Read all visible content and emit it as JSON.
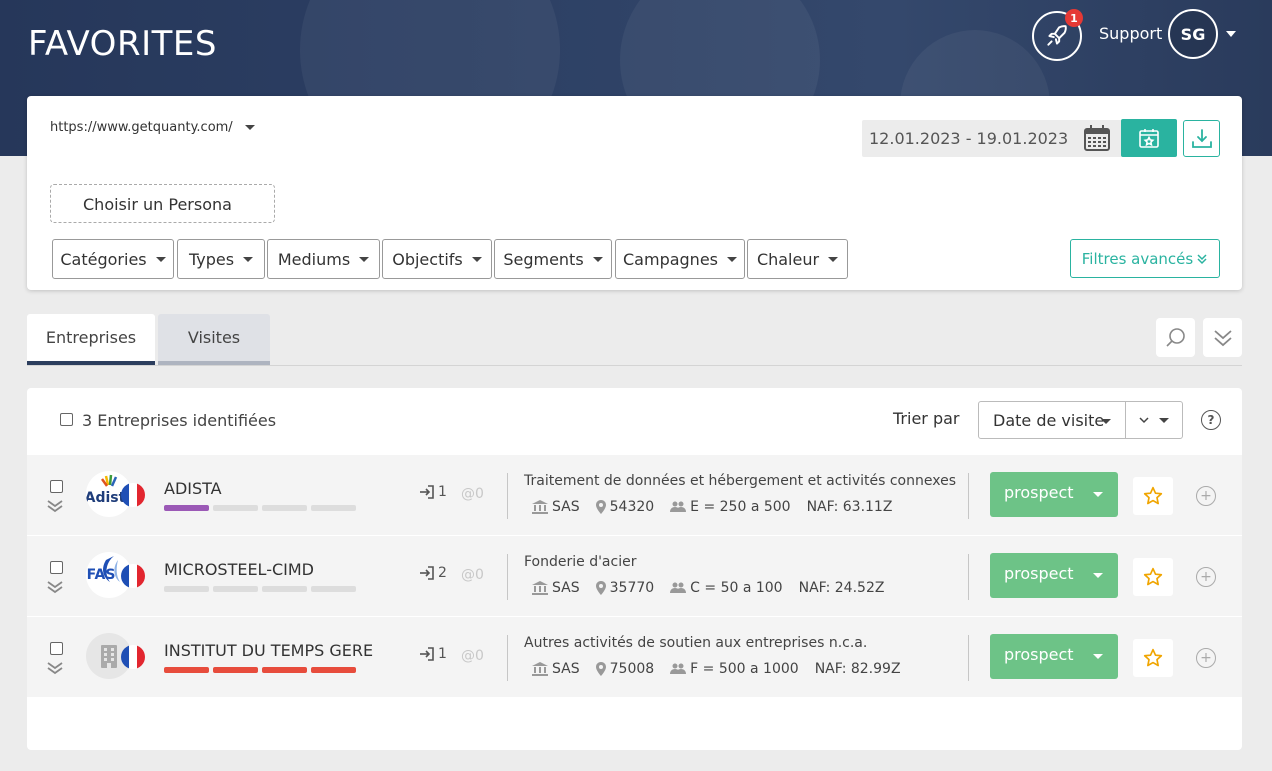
{
  "header": {
    "title": "FAVORITES",
    "notification_count": "1",
    "support_label": "Support",
    "user_initials": "SG"
  },
  "filters": {
    "site_url": "https://www.getquanty.com/",
    "date_range": "12.01.2023 - 19.01.2023",
    "persona_label": "Choisir un Persona",
    "chips": [
      "Catégories",
      "Types",
      "Mediums",
      "Objectifs",
      "Segments",
      "Campagnes",
      "Chaleur"
    ],
    "advanced_label": "Filtres avancés"
  },
  "tabs": {
    "companies": "Entreprises",
    "visits": "Visites"
  },
  "list": {
    "count_label": "3 Entreprises identifiées",
    "sort_label": "Trier par",
    "sort_value": "Date de visite",
    "help": "?",
    "rows": [
      {
        "logo_text": "Adist",
        "name": "ADISTA",
        "visits": "1",
        "emails": "@0",
        "activity": "Traitement de données et hébergement et activités connexes",
        "legal": "SAS",
        "postal": "54320",
        "size": "E = 250 a 500",
        "naf": "NAF: 63.11Z",
        "status": "prospect"
      },
      {
        "logo_text": "FAS",
        "name": "MICROSTEEL-CIMD",
        "visits": "2",
        "emails": "@0",
        "activity": "Fonderie d'acier",
        "legal": "SAS",
        "postal": "35770",
        "size": "C = 50 a 100",
        "naf": "NAF: 24.52Z",
        "status": "prospect"
      },
      {
        "logo_text": "",
        "name": "INSTITUT DU TEMPS GERE",
        "visits": "1",
        "emails": "@0",
        "activity": "Autres activités de soutien aux entreprises n.c.a.",
        "legal": "SAS",
        "postal": "75008",
        "size": "F = 500 a 1000",
        "naf": "NAF: 82.99Z",
        "status": "prospect"
      }
    ]
  },
  "colors": {
    "accent": "#2ab3a0",
    "status_green": "#6dc387",
    "star": "#f0a500",
    "header_navy": "#2c3f63",
    "heat_purple": "#9b59b6",
    "heat_red": "#e74c3c"
  },
  "heat_levels": [
    1,
    0,
    4
  ]
}
